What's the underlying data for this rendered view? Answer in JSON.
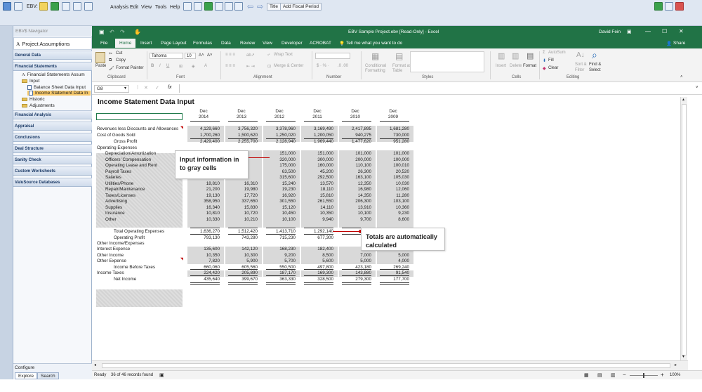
{
  "topbar": {
    "ebv_label": "EBV:",
    "menus": [
      "Analysis",
      "Edit",
      "View",
      "Tools",
      "Help"
    ],
    "buttons": [
      "Title",
      "Add Fiscal Period"
    ]
  },
  "navigator": {
    "title": "EBV$ Navigator",
    "project": "Project Assumptions",
    "sections": [
      "General Data",
      "Financial Statements"
    ],
    "tree": [
      "Financial Statements Assum",
      "Input",
      "Balance Sheet Data Input",
      "Income Statement Data In",
      "Historic",
      "Adjustments"
    ],
    "sections2": [
      "Financial Analysis",
      "Appraisal",
      "Conclusions",
      "Deal Structure",
      "Sanity Check",
      "Custom Worksheets",
      "ValuSource Databases"
    ],
    "configure": "Configure",
    "tabs": [
      "Explore",
      "Search"
    ]
  },
  "excel": {
    "title": "EBV Sample Project.ebv  [Read-Only] - Excel",
    "user": "David Fein",
    "share": "Share",
    "tabs": [
      "File",
      "Home",
      "Insert",
      "Page Layout",
      "Formulas",
      "Data",
      "Review",
      "View",
      "Developer",
      "ACROBAT"
    ],
    "tell_me": "Tell me what you want to do",
    "ribbon": {
      "cut": "Cut",
      "copy": "Copy",
      "paste": "Paste",
      "format_painter": "Format Painter",
      "font_name": "Tahoma",
      "font_size": "10",
      "wrap_text": "Wrap Text",
      "merge_center": "Merge & Center",
      "conditional": "Conditional",
      "formatting": "Formatting",
      "format_as": "Format as",
      "table": "Table",
      "insert": "Insert",
      "delete": "Delete",
      "format": "Format",
      "autosum": "AutoSum",
      "fill": "Fill",
      "clear": "Clear",
      "sort": "Sort &",
      "filter": "Filter",
      "find": "Find &",
      "select": "Select",
      "groups": [
        "Clipboard",
        "Font",
        "Alignment",
        "Number",
        "Styles",
        "Cells",
        "Editing"
      ]
    },
    "name_box": "G8",
    "status_ready": "Ready",
    "status_records": "36 of 46 records found",
    "zoom": "100%"
  },
  "sheet": {
    "title": "Income Statement Data Input",
    "years": [
      {
        "top": "Dec",
        "bottom": "2014"
      },
      {
        "top": "Dec",
        "bottom": "2013"
      },
      {
        "top": "Dec",
        "bottom": "2012"
      },
      {
        "top": "Dec",
        "bottom": "2011"
      },
      {
        "top": "Dec",
        "bottom": "2010"
      },
      {
        "top": "Dec",
        "bottom": "2009"
      }
    ],
    "rows": [
      {
        "label": "Revenues less Discounts and Allowances",
        "values": [
          "4,129,660",
          "3,756,320",
          "3,378,960",
          "3,169,490",
          "2,417,895",
          "1,681,280"
        ]
      },
      {
        "label": "Cost of Goods Sold",
        "values": [
          "1,700,260",
          "1,500,620",
          "1,250,020",
          "1,200,050",
          "940,275",
          "730,000"
        ]
      },
      {
        "label": "Gross Profit",
        "values": [
          "2,429,400",
          "2,255,700",
          "2,128,940",
          "1,969,440",
          "1,477,620",
          "951,280"
        ]
      },
      {
        "label": "Operating Expenses",
        "values": [
          "",
          "",
          "",
          "",
          "",
          ""
        ]
      },
      {
        "label": "Depreciation/Amortization",
        "values": [
          "",
          "",
          "151,000",
          "151,000",
          "101,000",
          "101,000"
        ]
      },
      {
        "label": "Officers' Compensation",
        "values": [
          "",
          "",
          "320,000",
          "300,000",
          "200,000",
          "100,000"
        ]
      },
      {
        "label": "Operating Lease and Rent",
        "values": [
          "",
          "",
          "175,000",
          "160,000",
          "110,100",
          "100,010"
        ]
      },
      {
        "label": "Payroll Taxes",
        "values": [
          "",
          "",
          "63,500",
          "45,200",
          "26,300",
          "20,520"
        ]
      },
      {
        "label": "Salaries",
        "values": [
          "",
          "",
          "315,600",
          "292,500",
          "163,100",
          "105,030"
        ]
      },
      {
        "label": "Utilities/Phone",
        "values": [
          "18,810",
          "16,310",
          "15,240",
          "13,570",
          "12,350",
          "10,030"
        ]
      },
      {
        "label": "Repair/Maintenance",
        "values": [
          "21,200",
          "19,980",
          "19,230",
          "18,110",
          "16,980",
          "12,060"
        ]
      },
      {
        "label": "Taxes/Licenses",
        "values": [
          "19,130",
          "17,720",
          "16,920",
          "15,810",
          "14,350",
          "11,280"
        ]
      },
      {
        "label": "Advertising",
        "values": [
          "358,950",
          "337,650",
          "301,550",
          "261,550",
          "206,300",
          "103,100"
        ]
      },
      {
        "label": "Supplies",
        "values": [
          "16,340",
          "15,830",
          "15,120",
          "14,110",
          "13,910",
          "10,360"
        ]
      },
      {
        "label": "Insurance",
        "values": [
          "10,810",
          "10,720",
          "10,450",
          "10,350",
          "10,100",
          "9,230"
        ]
      },
      {
        "label": "Other",
        "values": [
          "10,330",
          "10,210",
          "10,100",
          "9,940",
          "9,700",
          "8,600"
        ]
      },
      {
        "label": "Total Operating Expenses",
        "values": [
          "1,636,270",
          "1,512,420",
          "1,413,710",
          "1,292,140",
          "",
          ""
        ]
      },
      {
        "label": "Operating Profit",
        "values": [
          "793,130",
          "743,280",
          "715,230",
          "677,300",
          "",
          ""
        ]
      },
      {
        "label": "Other Income/Expenses",
        "values": [
          "",
          "",
          "",
          "",
          "",
          ""
        ]
      },
      {
        "label": "Interest Expense",
        "values": [
          "135,600",
          "142,120",
          "168,230",
          "182,400",
          "",
          ""
        ]
      },
      {
        "label": "Other Income",
        "values": [
          "10,350",
          "10,300",
          "9,200",
          "8,500",
          "7,000",
          "5,000"
        ]
      },
      {
        "label": "Other Expense",
        "values": [
          "7,820",
          "5,900",
          "5,700",
          "5,600",
          "5,000",
          "4,000"
        ]
      },
      {
        "label": "Income Before Taxes",
        "values": [
          "660,060",
          "605,560",
          "550,500",
          "497,800",
          "423,180",
          "269,240"
        ]
      },
      {
        "label": "Income Taxes",
        "values": [
          "224,420",
          "205,890",
          "187,170",
          "169,300",
          "143,880",
          "91,540"
        ]
      },
      {
        "label": "Net Income",
        "values": [
          "435,640",
          "399,670",
          "363,330",
          "328,500",
          "279,300",
          "177,700"
        ]
      }
    ],
    "callout_gray": "Input information in to gray cells",
    "callout_totals": "Totals are automatically calculated"
  },
  "colors": {
    "excel_green": "#217346",
    "gray_input": "#d9d9d9",
    "callout_red": "#c00000"
  }
}
